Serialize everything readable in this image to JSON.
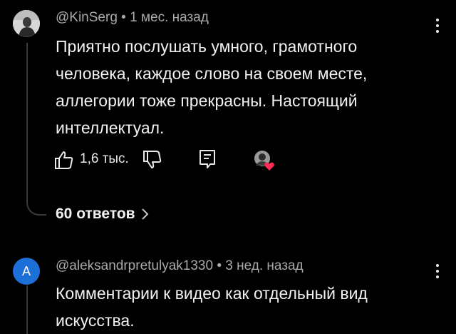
{
  "comment1": {
    "author": "@KinSerg",
    "separator": "•",
    "time": "1 мес. назад",
    "text": "Приятно послушать умного, грамотного человека, каждое слово на своем месте, аллегории тоже прекрасны. Настоящий интеллектуал.",
    "likes": "1,6 тыс.",
    "replies_label": "60 ответов",
    "replies_icon": "chevron-right-icon"
  },
  "comment2": {
    "avatar_letter": "A",
    "avatar_color": "#1c6fd6",
    "author": "@aleksandrpretulyak1330",
    "separator": "•",
    "time": "3 нед. назад",
    "text": "Комментарии к видео как отдельный вид искусства."
  },
  "colors": {
    "background": "#000000",
    "text": "#f1f1f1",
    "meta": "#aaaaaa",
    "heart": "#ff2d55"
  }
}
